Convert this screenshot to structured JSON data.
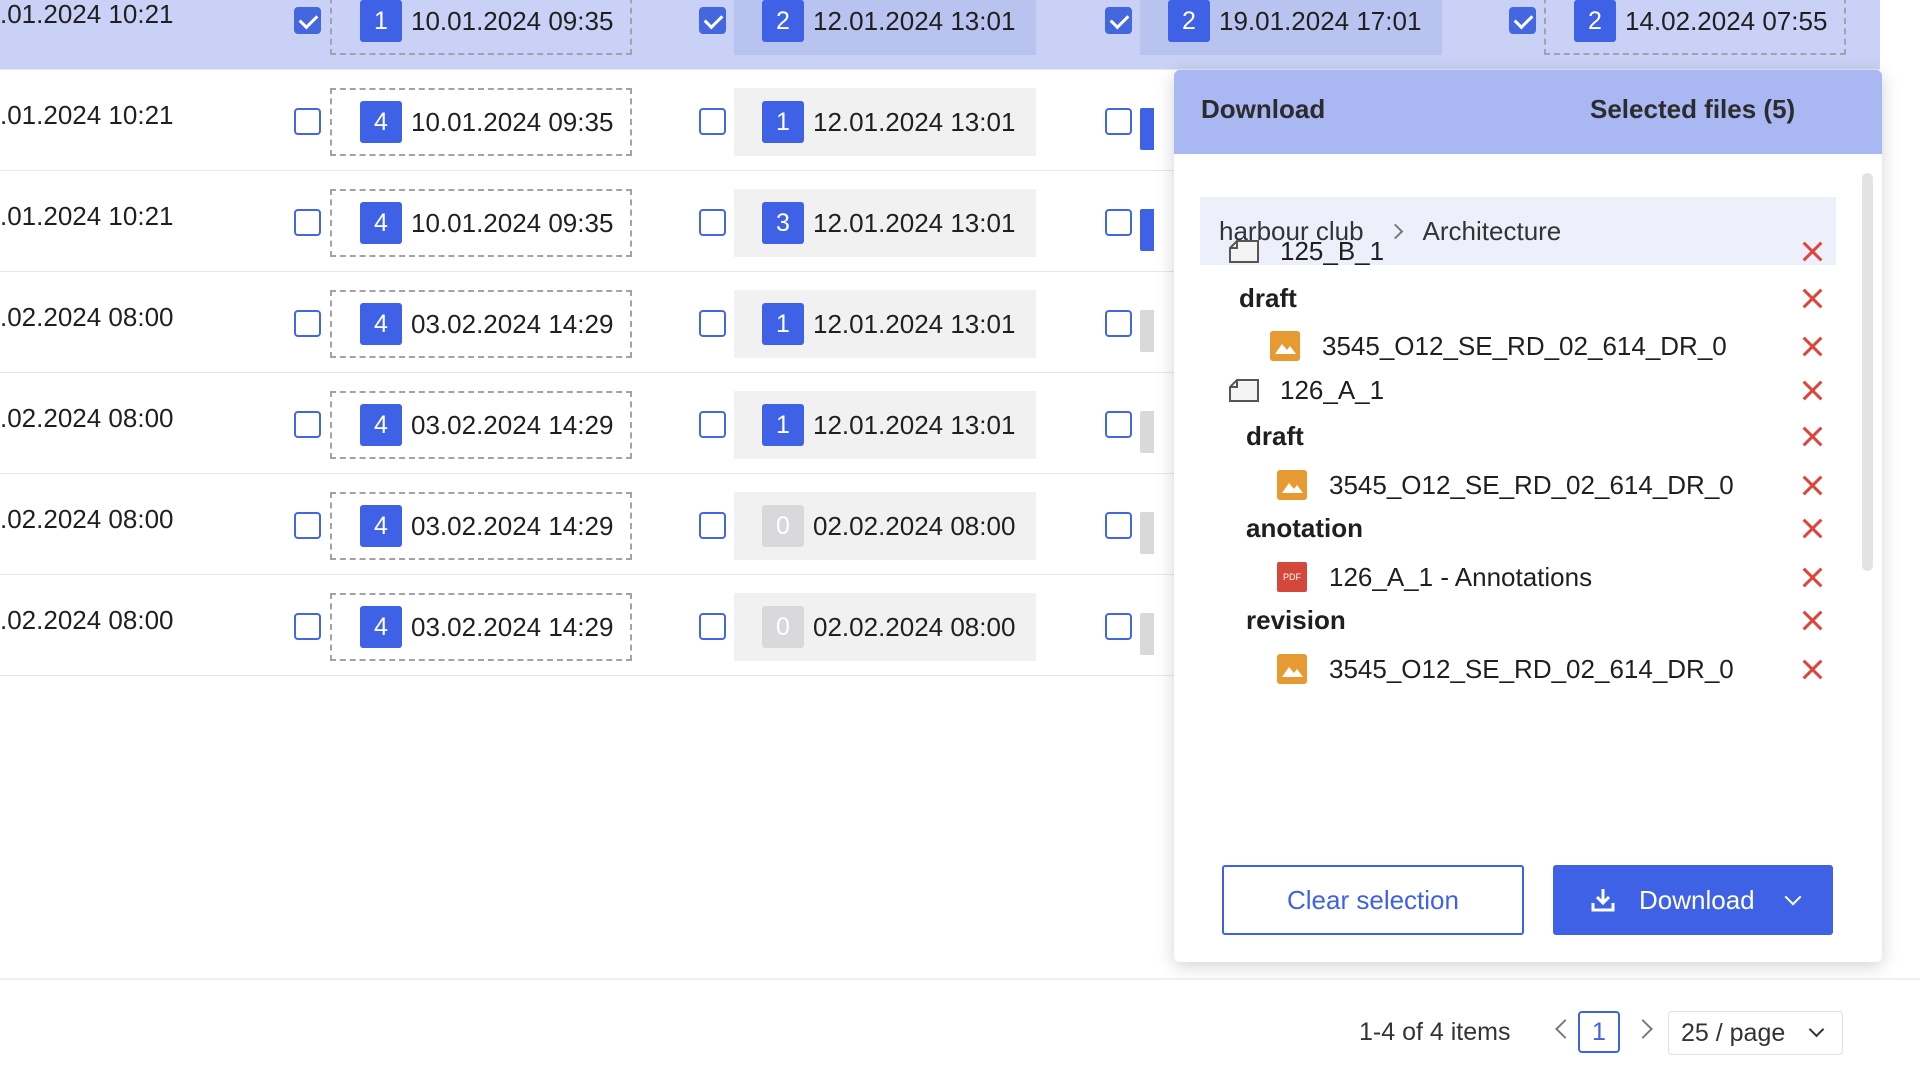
{
  "table": {
    "rows": [
      {
        "selected": true,
        "first_date": ".01.2024 10:21",
        "cols": [
          {
            "checked": true,
            "style": "dashed",
            "badge": "1",
            "date": "10.01.2024 09:35"
          },
          {
            "checked": true,
            "style": "plain",
            "badge": "2",
            "date": "12.01.2024 13:01"
          },
          {
            "checked": true,
            "style": "plain",
            "badge": "2",
            "date": "19.01.2024 17:01"
          },
          {
            "checked": true,
            "style": "dashed",
            "badge": "2",
            "date": "14.02.2024 07:55"
          }
        ]
      },
      {
        "selected": false,
        "first_date": ".01.2024 10:21",
        "cols": [
          {
            "checked": false,
            "style": "dashed",
            "badge": "4",
            "date": "10.01.2024 09:35"
          },
          {
            "checked": false,
            "style": "plain",
            "badge": "1",
            "date": "12.01.2024 13:01"
          },
          {
            "checked": false,
            "stub": "blue"
          }
        ]
      },
      {
        "selected": false,
        "first_date": ".01.2024 10:21",
        "cols": [
          {
            "checked": false,
            "style": "dashed",
            "badge": "4",
            "date": "10.01.2024 09:35"
          },
          {
            "checked": false,
            "style": "plain",
            "badge": "3",
            "date": "12.01.2024 13:01"
          },
          {
            "checked": false,
            "stub": "blue"
          }
        ]
      },
      {
        "selected": false,
        "first_date": ".02.2024 08:00",
        "cols": [
          {
            "checked": false,
            "style": "dashed",
            "badge": "4",
            "date": "03.02.2024 14:29"
          },
          {
            "checked": false,
            "style": "plain",
            "badge": "1",
            "date": "12.01.2024 13:01"
          },
          {
            "checked": false,
            "stub": "grey"
          }
        ]
      },
      {
        "selected": false,
        "first_date": ".02.2024 08:00",
        "cols": [
          {
            "checked": false,
            "style": "dashed",
            "badge": "4",
            "date": "03.02.2024 14:29"
          },
          {
            "checked": false,
            "style": "plain",
            "badge": "1",
            "date": "12.01.2024 13:01"
          },
          {
            "checked": false,
            "stub": "grey"
          }
        ]
      },
      {
        "selected": false,
        "first_date": ".02.2024 08:00",
        "cols": [
          {
            "checked": false,
            "style": "dashed",
            "badge": "4",
            "date": "03.02.2024 14:29"
          },
          {
            "checked": false,
            "style": "plain",
            "badge": "0",
            "date": "02.02.2024 08:00"
          },
          {
            "checked": false,
            "stub": "grey"
          }
        ]
      },
      {
        "selected": false,
        "first_date": ".02.2024 08:00",
        "cols": [
          {
            "checked": false,
            "style": "dashed",
            "badge": "4",
            "date": "03.02.2024 14:29"
          },
          {
            "checked": false,
            "style": "plain",
            "badge": "0",
            "date": "02.02.2024 08:00"
          },
          {
            "checked": false,
            "stub": "grey"
          }
        ]
      }
    ]
  },
  "pagination": {
    "summary": "1-4 of 4 items",
    "current_page": "1",
    "page_size": "25 / page"
  },
  "download_panel": {
    "title": "Download",
    "selected_count": "Selected files (5)",
    "breadcrumb": {
      "root": "harbour club",
      "current": "Architecture"
    },
    "items": [
      {
        "kind": "drive",
        "label": "125_B_1"
      },
      {
        "kind": "folder",
        "label": "draft"
      },
      {
        "kind": "image",
        "label": "3545_O12_SE_RD_02_614_DR_0"
      },
      {
        "kind": "drive",
        "label": "126_A_1"
      },
      {
        "kind": "folder",
        "label": "draft"
      },
      {
        "kind": "image",
        "label": "3545_O12_SE_RD_02_614_DR_0"
      },
      {
        "kind": "folder",
        "label": "anotation"
      },
      {
        "kind": "pdf",
        "label": "126_A_1 - Annotations"
      },
      {
        "kind": "folder",
        "label": "revision"
      },
      {
        "kind": "image",
        "label": "3545_O12_SE_RD_02_614_DR_0"
      }
    ],
    "pdf_icon_text": "PDF",
    "clear_button": "Clear selection",
    "download_button": "Download"
  },
  "colors": {
    "accent": "#3f61e6",
    "selected_row": "#c9d2f6",
    "panel_header": "#a9b7f3",
    "remove": "#e0433b",
    "image_icon": "#e79a32",
    "pdf_icon": "#d4473b"
  }
}
